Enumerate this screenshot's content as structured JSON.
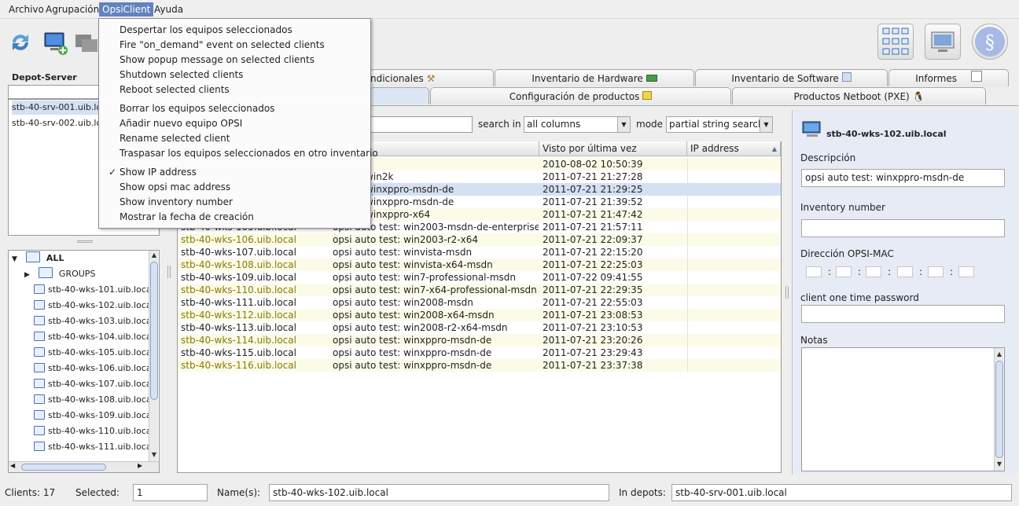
{
  "menubar": {
    "items": [
      "Archivo",
      "Agrupación",
      "OpsiClient",
      "Ayuda"
    ]
  },
  "dropdown": {
    "group1": [
      "Despertar los equipos seleccionados",
      "Fire \"on_demand\" event on selected clients",
      "Show popup message on selected clients",
      "Shutdown selected clients",
      "Reboot selected clients"
    ],
    "group2": [
      "Borrar los equipos seleccionados",
      "Añadir nuevo equipo OPSI",
      "Rename selected client",
      "Traspasar los equipos seleccionados en otro inventario"
    ],
    "group3": [
      "Show IP address",
      "Show opsi mac address",
      "Show inventory number",
      "Mostrar la fecha de creación"
    ],
    "check_mark": "✓"
  },
  "depot": {
    "label": "Depot-Server",
    "items": [
      "stb-40-srv-001.uib.local",
      "stb-40-srv-002.uib.local"
    ]
  },
  "tree": {
    "root": "ALL",
    "groups": "GROUPS",
    "clients": [
      "stb-40-wks-101.uib.local",
      "stb-40-wks-102.uib.local",
      "stb-40-wks-103.uib.local",
      "stb-40-wks-104.uib.local",
      "stb-40-wks-105.uib.local",
      "stb-40-wks-106.uib.local",
      "stb-40-wks-107.uib.local",
      "stb-40-wks-108.uib.local",
      "stb-40-wks-109.uib.local",
      "stb-40-wks-110.uib.local",
      "stb-40-wks-111.uib.local"
    ]
  },
  "tabs": {
    "row1": [
      "ndicionales",
      "Inventario de Hardware",
      "Inventario de Software",
      "Informes"
    ],
    "row2": [
      "Configuración de productos",
      "Productos Netboot (PXE)"
    ]
  },
  "search": {
    "search_in_label": "search in",
    "search_in_value": "all columns",
    "mode_label": "mode",
    "mode_value": "partial string search"
  },
  "table": {
    "headers": [
      "ión",
      "Visto por última vez",
      "IP address"
    ],
    "sort_arrow": "▲",
    "rows": [
      {
        "client": "",
        "desc": "",
        "seen": "2010-08-02 10:50:39"
      },
      {
        "client": "",
        "desc": "o test: win2k",
        "seen": "2011-07-21 21:27:28"
      },
      {
        "client": "",
        "desc": "o test: winxppro-msdn-de",
        "seen": "2011-07-21 21:29:25"
      },
      {
        "client": "",
        "desc": "o test: winxppro-msdn-de",
        "seen": "2011-07-21 21:39:52"
      },
      {
        "client": "",
        "desc": "o test: winxppro-x64",
        "seen": "2011-07-21 21:47:42"
      },
      {
        "client": "stb-40-wks-105.uib.local",
        "desc": "opsi auto test: win2003-msdn-de-enterprise-...",
        "seen": "2011-07-21 21:57:11"
      },
      {
        "client": "stb-40-wks-106.uib.local",
        "desc": "opsi auto test: win2003-r2-x64",
        "seen": "2011-07-21 22:09:37"
      },
      {
        "client": "stb-40-wks-107.uib.local",
        "desc": "opsi auto test: winvista-msdn",
        "seen": "2011-07-21 22:15:20"
      },
      {
        "client": "stb-40-wks-108.uib.local",
        "desc": "opsi auto test: winvista-x64-msdn",
        "seen": "2011-07-21 22:25:03"
      },
      {
        "client": "stb-40-wks-109.uib.local",
        "desc": "opsi auto test: win7-professional-msdn",
        "seen": "2011-07-22 09:41:55"
      },
      {
        "client": "stb-40-wks-110.uib.local",
        "desc": "opsi auto test: win7-x64-professional-msdn",
        "seen": "2011-07-21 22:29:35"
      },
      {
        "client": "stb-40-wks-111.uib.local",
        "desc": "opsi auto test: win2008-msdn",
        "seen": "2011-07-21 22:55:03"
      },
      {
        "client": "stb-40-wks-112.uib.local",
        "desc": "opsi auto test: win2008-x64-msdn",
        "seen": "2011-07-21 23:08:53"
      },
      {
        "client": "stb-40-wks-113.uib.local",
        "desc": "opsi auto test: win2008-r2-x64-msdn",
        "seen": "2011-07-21 23:10:53"
      },
      {
        "client": "stb-40-wks-114.uib.local",
        "desc": "opsi auto test: winxppro-msdn-de",
        "seen": "2011-07-21 23:20:26"
      },
      {
        "client": "stb-40-wks-115.uib.local",
        "desc": "opsi auto test: winxppro-msdn-de",
        "seen": "2011-07-21 23:29:43"
      },
      {
        "client": "stb-40-wks-116.uib.local",
        "desc": "opsi auto test: winxppro-msdn-de",
        "seen": "2011-07-21 23:37:38"
      }
    ]
  },
  "detail": {
    "client_name": "stb-40-wks-102.uib.local",
    "description_label": "Descripción",
    "description_value": "opsi auto test: winxppro-msdn-de",
    "inventory_label": "Inventory number",
    "inventory_value": "",
    "mac_label": "Dirección OPSI-MAC",
    "mac_sep": ":",
    "otp_label": "client one time password",
    "otp_value": "",
    "notes_label": "Notas"
  },
  "status": {
    "clients": "Clients: 17",
    "selected_label": "Selected:",
    "selected_value": "1",
    "names_label": "Name(s):",
    "names_value": "stb-40-wks-102.uib.local",
    "depots_label": "In depots:",
    "depots_value": "stb-40-srv-001.uib.local"
  },
  "colors": {
    "menu_active": "#6382bf",
    "row_odd": "#fbfbe8",
    "row_selected": "#d4e0f4",
    "client_text_yellow": "#8a7a00"
  }
}
